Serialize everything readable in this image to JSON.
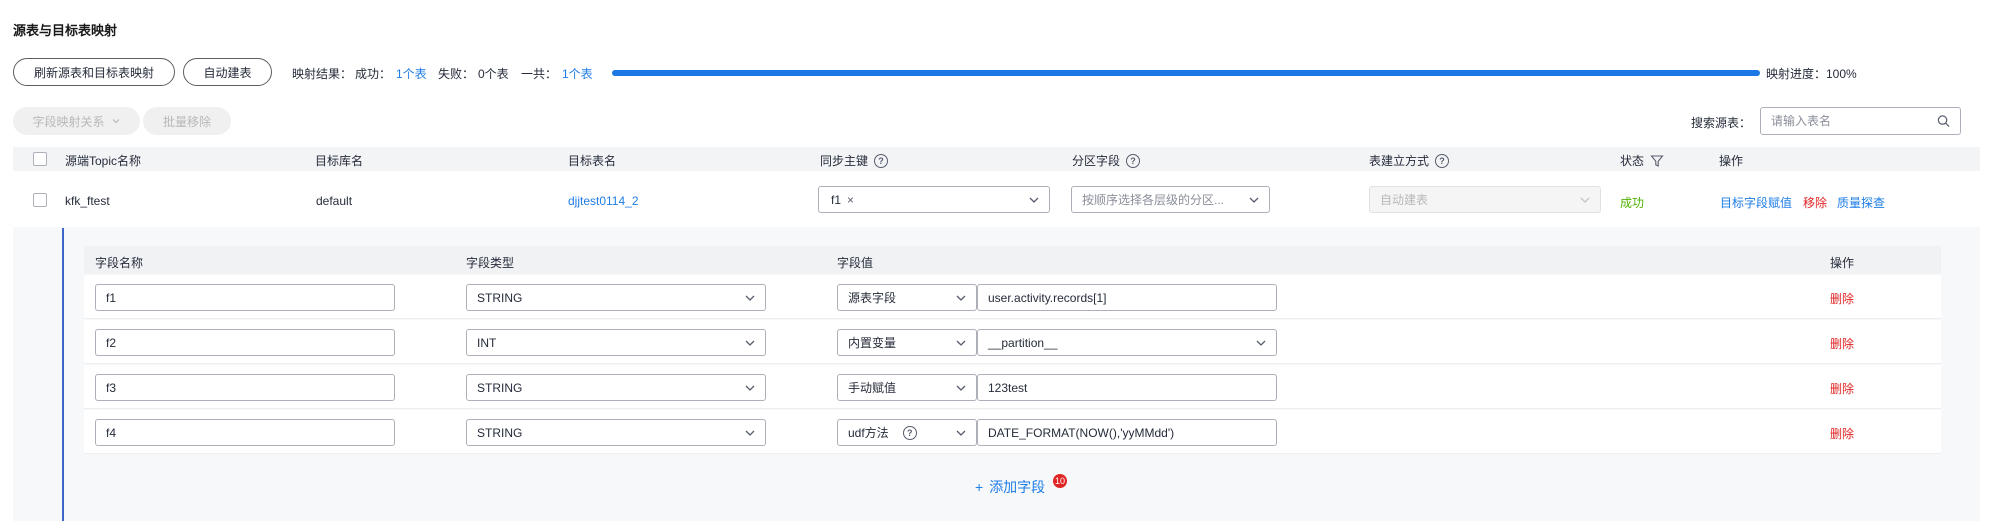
{
  "page": {
    "title": "源表与目标表映射"
  },
  "toolbar": {
    "refresh_label": "刷新源表和目标表映射",
    "auto_create_label": "自动建表"
  },
  "mapping_result": {
    "label": "映射结果：",
    "success_label": "成功：",
    "success_value": "1个表",
    "fail_label": "失败：",
    "fail_value": "0个表",
    "total_label": "一共：",
    "total_value": "1个表",
    "progress_label": "映射进度：100%",
    "progress_fraction": 1.0
  },
  "actions": {
    "field_mapping_label": "字段映射关系",
    "batch_remove_label": "批量移除"
  },
  "search": {
    "label": "搜索源表：",
    "placeholder": "请输入表名"
  },
  "table": {
    "headers": {
      "source_topic": "源端Topic名称",
      "target_db": "目标库名",
      "target_table": "目标表名",
      "sync_pk": "同步主键",
      "partition": "分区字段",
      "create_mode": "表建立方式",
      "status": "状态",
      "ops": "操作"
    },
    "row": {
      "source_topic": "kfk_ftest",
      "target_db": "default",
      "target_table": "djjtest0114_2",
      "sync_pk_tag": "f1",
      "partition_placeholder": "按顺序选择各层级的分区...",
      "create_mode": "自动建表",
      "status": "成功",
      "op_assign": "目标字段赋值",
      "op_remove": "移除",
      "op_quality": "质量探查"
    }
  },
  "fields": {
    "headers": {
      "name": "字段名称",
      "type": "字段类型",
      "value": "字段值",
      "ops": "操作"
    },
    "rows": [
      {
        "name": "f1",
        "type": "STRING",
        "value_type": "源表字段",
        "value": "user.activity.records[1]",
        "op": "删除"
      },
      {
        "name": "f2",
        "type": "INT",
        "value_type": "内置变量",
        "value": "__partition__",
        "op": "删除"
      },
      {
        "name": "f3",
        "type": "STRING",
        "value_type": "手动赋值",
        "value": "123test",
        "op": "删除"
      },
      {
        "name": "f4",
        "type": "STRING",
        "value_type": "udf方法",
        "value": "DATE_FORMAT(NOW(),'yyMMdd')",
        "op": "删除"
      }
    ],
    "add_label": "添加字段",
    "badge": "10"
  },
  "icons": {
    "help": "?",
    "filter": "filter-icon",
    "search": "search-icon",
    "close": "×",
    "plus": "+"
  }
}
